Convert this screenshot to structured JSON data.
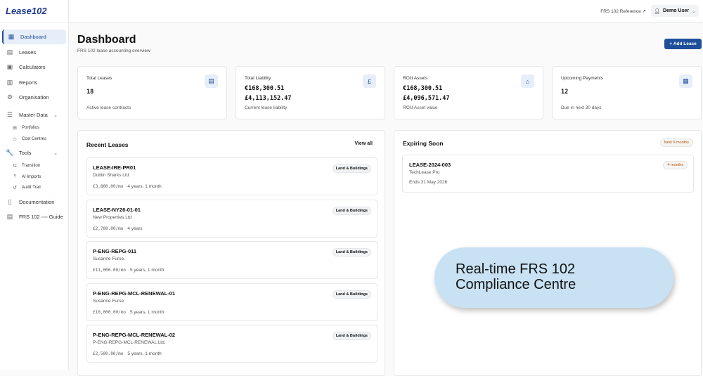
{
  "app": {
    "logo": "Lease102"
  },
  "sidebar": {
    "items": [
      {
        "label": "Dashboard",
        "icon": "grid-icon"
      },
      {
        "label": "Leases",
        "icon": "file-icon"
      },
      {
        "label": "Calculators",
        "icon": "calculator-icon"
      },
      {
        "label": "Reports",
        "icon": "bar-chart-icon"
      },
      {
        "label": "Organisation",
        "icon": "gear-icon"
      },
      {
        "label": "Master Data",
        "icon": "database-icon"
      },
      {
        "label": "Portfolios",
        "icon": "briefcase-icon"
      },
      {
        "label": "Cost Centres",
        "icon": "tag-icon"
      },
      {
        "label": "Tools",
        "icon": "wrench-icon"
      },
      {
        "label": "Transition",
        "icon": "arrows-icon"
      },
      {
        "label": "AI Imports",
        "icon": "upload-icon"
      },
      {
        "label": "Audit Trail",
        "icon": "history-icon"
      },
      {
        "label": "Documentation",
        "icon": "book-icon"
      },
      {
        "label": "FRS 102",
        "sup": "2026",
        "label2": "Guide",
        "icon": "file-icon"
      }
    ]
  },
  "topbar": {
    "reference": "FRS 102 Reference",
    "user": "Demo User"
  },
  "page": {
    "title": "Dashboard",
    "subtitle": "FRS 102 lease accounting overview",
    "add_label": "Add Lease"
  },
  "cards": [
    {
      "label": "Total Leases",
      "value": "18",
      "desc": "Active lease contracts"
    },
    {
      "label": "Total Liability",
      "value": "€168,300.51",
      "value2": "£4,113,152.47",
      "desc": "Current lease liability"
    },
    {
      "label": "ROU Assets",
      "value": "€168,300.51",
      "value2": "£4,096,571.47",
      "desc": "ROU Asset value"
    },
    {
      "label": "Upcoming Payments",
      "value": "12",
      "desc": "Due in next 30 days"
    }
  ],
  "recent": {
    "title": "Recent Leases",
    "view_all": "View all",
    "items": [
      {
        "id": "LEASE-IRE-PR01",
        "name": "Dublin Sharks Ltd",
        "amount": "€3,800.00/mo",
        "term": "4 years, 1 month",
        "tag": "Land & Buildings"
      },
      {
        "id": "LEASE-NY26-01-01",
        "name": "New Properties Ltd",
        "amount": "£2,700.00/mo",
        "term": "4 years",
        "tag": "Land & Buildings"
      },
      {
        "id": "P-ENG-REPG-011",
        "name": "Susanne Furse.",
        "amount": "£11,000.00/mo",
        "term": "5 years, 1 month",
        "tag": "Land & Buildings"
      },
      {
        "id": "P-ENG-REPG-MCL-RENEWAL-01",
        "name": "Susanne Furse",
        "amount": "£10,000.00/mo",
        "term": "5 years, 1 month",
        "tag": "Land & Buildings"
      },
      {
        "id": "P-ENG-REPG-MCL-RENEWAL-02",
        "name": "P-ENG-REPG-MCL-RENEWAL Ltd.",
        "amount": "£2,500.00/mo",
        "term": "5 years, 1 month",
        "tag": "Land & Buildings"
      }
    ]
  },
  "expiring": {
    "title": "Expiring Soon",
    "badge": "Next 6 months",
    "items": [
      {
        "id": "LEASE-2024-003",
        "name": "TechLease Pro",
        "ends": "Ends 31 May 2026",
        "badge": "4 months"
      }
    ]
  },
  "callout": {
    "text": "Real-time FRS 102 Compliance Centre"
  }
}
